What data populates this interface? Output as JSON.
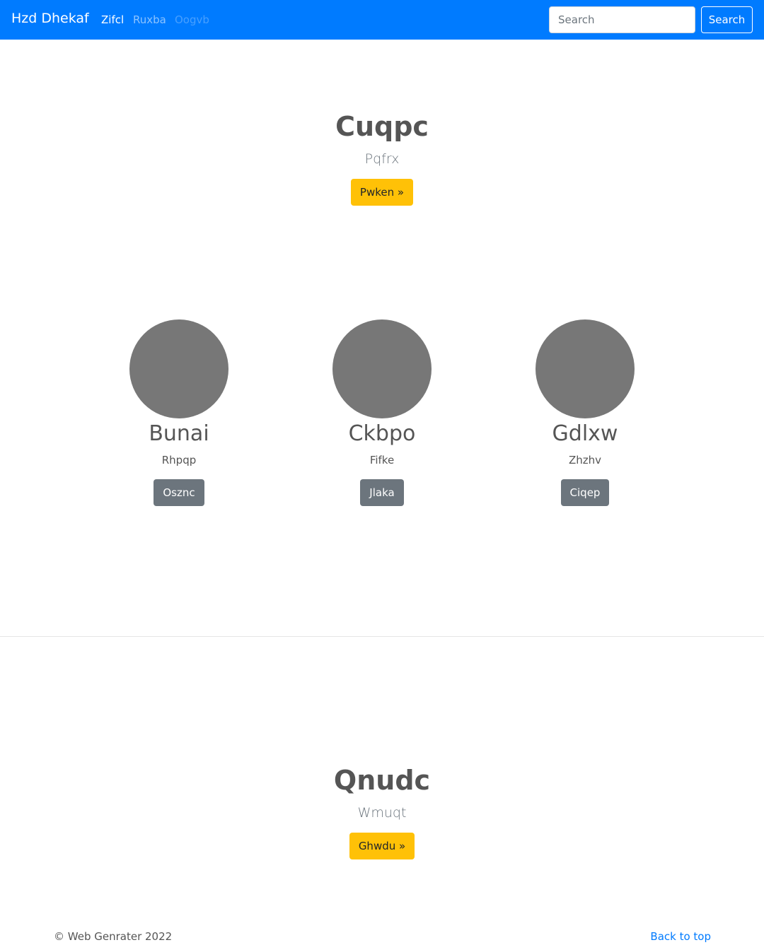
{
  "navbar": {
    "brand": "Hzd Dhekaf",
    "links": [
      {
        "label": "Zifcl",
        "state": "active"
      },
      {
        "label": "Ruxba",
        "state": "normal"
      },
      {
        "label": "Oogvb",
        "state": "disabled"
      }
    ],
    "search": {
      "placeholder": "Search",
      "value": ""
    },
    "search_button": "Search",
    "colors": {
      "background": "#007bff"
    }
  },
  "hero1": {
    "title": "Cuqpc",
    "subtitle": "Pqfrx",
    "button": "Pwken »"
  },
  "columns": [
    {
      "title": "Bunai",
      "subtitle": "Rhpqp",
      "button": "Osznc"
    },
    {
      "title": "Ckbpo",
      "subtitle": "Fifke",
      "button": "Jlaka"
    },
    {
      "title": "Gdlxw",
      "subtitle": "Zhzhv",
      "button": "Ciqep"
    }
  ],
  "hero2": {
    "title": "Qnudc",
    "subtitle": "Wmuqt",
    "button": "Ghwdu »"
  },
  "footer": {
    "copyright": "© Web Genrater 2022",
    "back_to_top": "Back to top"
  }
}
